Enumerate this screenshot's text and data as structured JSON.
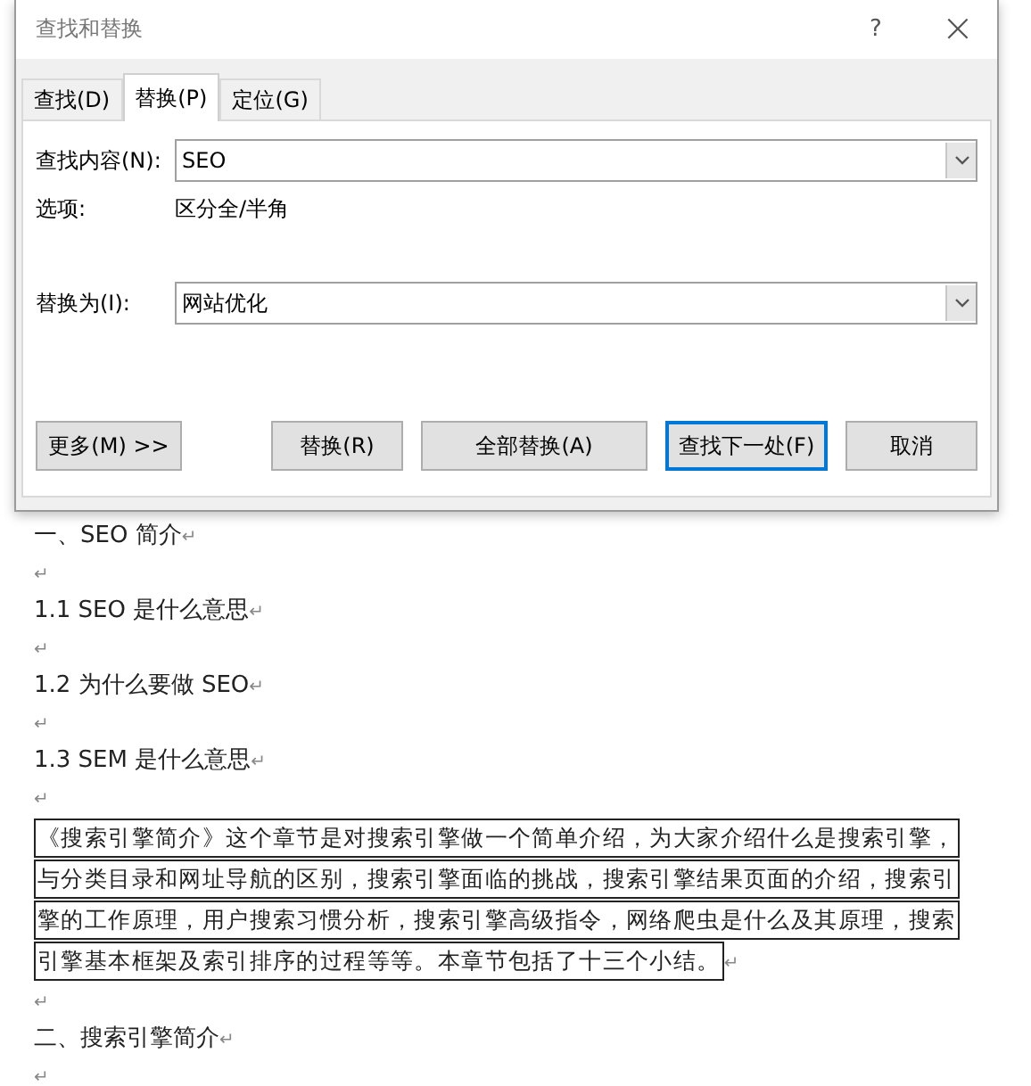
{
  "dialog": {
    "title": "查找和替换",
    "help": "?",
    "close": "×",
    "tabs": [
      {
        "label": "查找(D)",
        "selected": false
      },
      {
        "label": "替换(P)",
        "selected": true
      },
      {
        "label": "定位(G)",
        "selected": false
      }
    ],
    "find": {
      "label": "查找内容(N):",
      "value": "SEO"
    },
    "options": {
      "label": "选项:",
      "value": "区分全/半角"
    },
    "replace": {
      "label": "替换为(I):",
      "value": "网站优化"
    },
    "buttons": [
      {
        "kind": "more",
        "label": "更多(M) >>",
        "focused": false
      },
      {
        "kind": "action",
        "label": "替换(R)",
        "focused": false
      },
      {
        "kind": "action",
        "label": "全部替换(A)",
        "focused": false
      },
      {
        "kind": "action",
        "label": "查找下一处(F)",
        "focused": true
      },
      {
        "kind": "action",
        "label": "取消",
        "focused": false
      }
    ]
  },
  "document": {
    "paragraphs": [
      {
        "kind": "line",
        "text": "一、SEO 简介",
        "mark": "↵"
      },
      {
        "kind": "empty",
        "mark": "↵"
      },
      {
        "kind": "line",
        "text": "1.1 SEO 是什么意思",
        "mark": "↵"
      },
      {
        "kind": "empty",
        "mark": "↵"
      },
      {
        "kind": "line",
        "text": "1.2  为什么要做 SEO",
        "mark": "↵"
      },
      {
        "kind": "empty",
        "mark": "↵"
      },
      {
        "kind": "line",
        "text": "1.3 SEM 是什么意思",
        "mark": "↵"
      },
      {
        "kind": "empty",
        "mark": "↵"
      },
      {
        "kind": "boxed",
        "lines": [
          "《搜索引擎简介》这个章节是对搜索引擎做一个简单介绍，为大家介绍什么是搜索引擎，",
          "与分类目录和网址导航的区别，搜索引擎面临的挑战，搜索引擎结果页面的介绍，搜索引",
          "擎的工作原理，用户搜索习惯分析，搜索引擎高级指令，网络爬虫是什么及其原理，搜索",
          "引擎基本框架及索引排序的过程等等。本章节包括了十三个小结。"
        ],
        "mark": "↵"
      },
      {
        "kind": "empty",
        "mark": "↵"
      },
      {
        "kind": "line",
        "text": "二、搜索引擎简介",
        "mark": "↵"
      },
      {
        "kind": "empty",
        "mark": "↵"
      }
    ]
  }
}
